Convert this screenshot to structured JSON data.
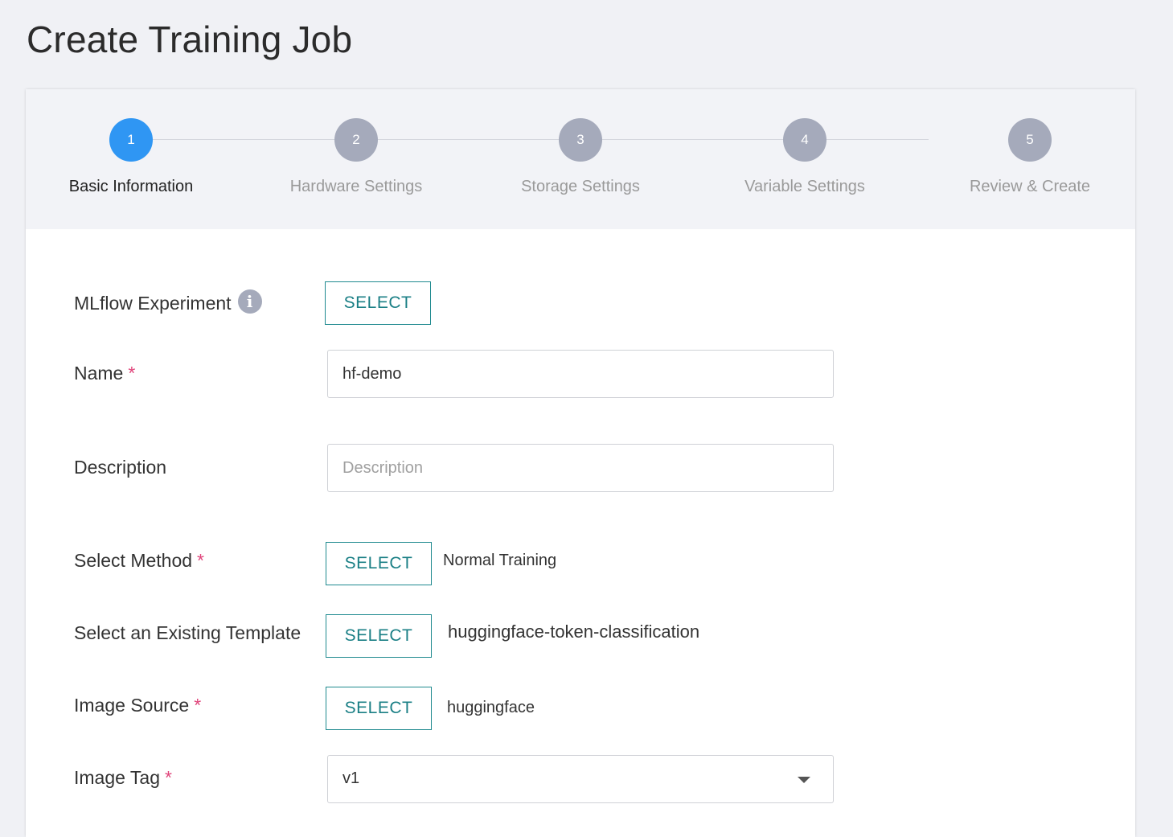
{
  "page": {
    "title": "Create Training Job"
  },
  "stepper": {
    "steps": [
      {
        "number": "1",
        "label": "Basic Information",
        "active": true
      },
      {
        "number": "2",
        "label": "Hardware Settings",
        "active": false
      },
      {
        "number": "3",
        "label": "Storage Settings",
        "active": false
      },
      {
        "number": "4",
        "label": "Variable Settings",
        "active": false
      },
      {
        "number": "5",
        "label": "Review & Create",
        "active": false
      }
    ]
  },
  "form": {
    "mlflow": {
      "label": "MLflow Experiment",
      "button": "SELECT",
      "info_icon": "i"
    },
    "name": {
      "label": "Name",
      "required": "*",
      "value": "hf-demo"
    },
    "description": {
      "label": "Description",
      "placeholder": "Description",
      "value": ""
    },
    "method": {
      "label": "Select Method",
      "required": "*",
      "button": "SELECT",
      "value": "Normal Training"
    },
    "template": {
      "label": "Select an Existing Template",
      "button": "SELECT",
      "value": "huggingface-token-classification"
    },
    "image_source": {
      "label": "Image Source",
      "required": "*",
      "button": "SELECT",
      "value": "huggingface"
    },
    "image_tag": {
      "label": "Image Tag",
      "required": "*",
      "value": "v1",
      "icon": "caret-down-icon"
    }
  },
  "colors": {
    "accent": "#2f96f3",
    "inactive_step": "#a5aabb",
    "button_teal": "#1a7f85",
    "required": "#e0457b",
    "background": "#f0f1f5"
  }
}
